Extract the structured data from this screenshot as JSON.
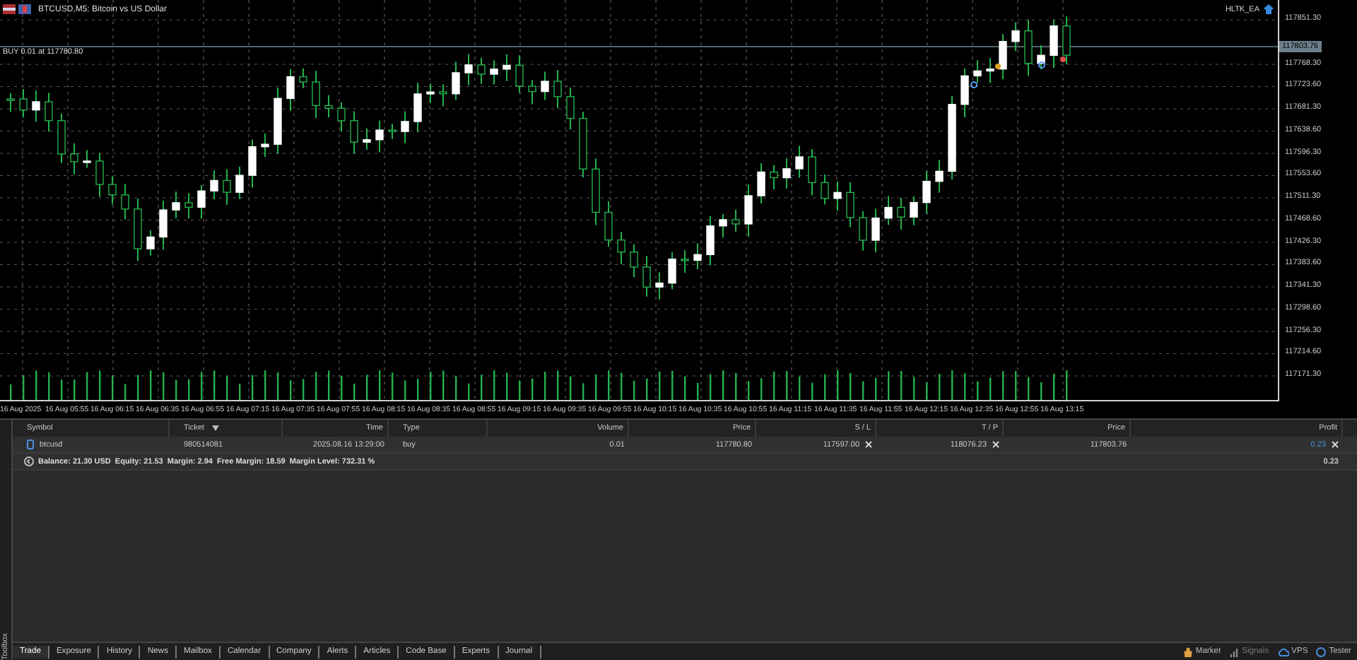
{
  "chart": {
    "title": "BTCUSD,M5: Bitcoin vs US Dollar",
    "trade_line": "BUY 0.01 at 117780.80",
    "expert": "HLTK_EA",
    "current_price": "117803.76",
    "price_labels": [
      "117851.30",
      "117768.30",
      "117723.60",
      "117681.30",
      "117638.60",
      "117596.30",
      "117553.60",
      "117511.30",
      "117468.60",
      "117426.30",
      "117383.60",
      "117341.30",
      "117298.60",
      "117256.30",
      "117214.60",
      "117171.30"
    ],
    "time_labels": [
      "16 Aug 2025",
      "16 Aug 05:55",
      "16 Aug 06:15",
      "16 Aug 06:35",
      "16 Aug 06:55",
      "16 Aug 07:15",
      "16 Aug 07:35",
      "16 Aug 07:55",
      "16 Aug 08:15",
      "16 Aug 08:35",
      "16 Aug 08:55",
      "16 Aug 09:15",
      "16 Aug 09:35",
      "16 Aug 09:55",
      "16 Aug 10:15",
      "16 Aug 10:35",
      "16 Aug 10:55",
      "16 Aug 11:15",
      "16 Aug 11:35",
      "16 Aug 11:55",
      "16 Aug 12:15",
      "16 Aug 12:35",
      "16 Aug 12:55",
      "16 Aug 13:15"
    ]
  },
  "trade_table": {
    "columns": [
      {
        "label": "Symbol",
        "sorted": false
      },
      {
        "label": "Ticket",
        "sorted": true
      },
      {
        "label": "Time",
        "sorted": false
      },
      {
        "label": "Type",
        "sorted": false
      },
      {
        "label": "Volume",
        "sorted": false
      },
      {
        "label": "Price",
        "sorted": false
      },
      {
        "label": "S / L",
        "sorted": false
      },
      {
        "label": "T / P",
        "sorted": false
      },
      {
        "label": "Price",
        "sorted": false
      },
      {
        "label": "Profit",
        "sorted": false
      }
    ],
    "rows": [
      {
        "cells": [
          "btcusd",
          "980514081",
          "2025.08.16 13:29:00",
          "buy",
          "0.01",
          "117780.80",
          "117597.00",
          "118076.23",
          "117803.76",
          "0.23"
        ]
      }
    ],
    "summary": "Balance: 21.30 USD  Equity: 21.53  Margin: 2.94  Free Margin: 18.59  Margin Level: 732.31 %",
    "summary_profit": "0.23"
  },
  "toolbox": {
    "title": "Toolbox",
    "tabs": [
      {
        "label": "Trade",
        "selected": true
      },
      {
        "label": "Exposure",
        "selected": false
      },
      {
        "label": "History",
        "selected": false
      },
      {
        "label": "News",
        "selected": false
      },
      {
        "label": "Mailbox",
        "selected": false
      },
      {
        "label": "Calendar",
        "selected": false
      },
      {
        "label": "Company",
        "selected": false
      },
      {
        "label": "Alerts",
        "selected": false
      },
      {
        "label": "Articles",
        "selected": false
      },
      {
        "label": "Code Base",
        "selected": false
      },
      {
        "label": "Experts",
        "selected": false
      },
      {
        "label": "Journal",
        "selected": false
      }
    ],
    "links": [
      {
        "label": "Market",
        "kind": "market"
      },
      {
        "label": "Signals",
        "kind": "signals"
      },
      {
        "label": "VPS",
        "kind": "vps"
      },
      {
        "label": "Tester",
        "kind": "tester"
      }
    ]
  }
}
